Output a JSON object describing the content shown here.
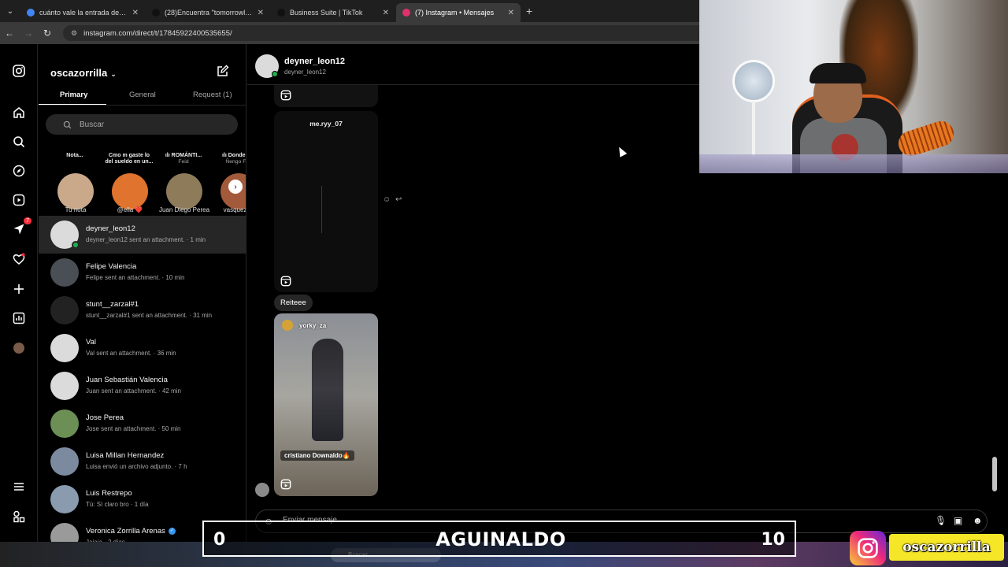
{
  "browser": {
    "tabs": [
      {
        "title": "cuánto vale la entrada de tomo",
        "active": false,
        "color": "#4285f4"
      },
      {
        "title": "(28)Encuentra \"tomorrowland b",
        "active": false,
        "color": "#111111"
      },
      {
        "title": "Business Suite | TikTok",
        "active": false,
        "color": "#111111"
      },
      {
        "title": "(7) Instagram • Mensajes",
        "active": true,
        "color": "#e1306c"
      }
    ],
    "new_tab": "+",
    "url": "instagram.com/direct/t/17845922400535655/"
  },
  "rail": {
    "messages_badge": "7"
  },
  "panel": {
    "account": "oscazorrilla",
    "tabs": [
      "Primary",
      "General",
      "Request (1)"
    ],
    "search_placeholder": "Buscar",
    "notes": [
      {
        "bubble": "Nota...",
        "bubble_sub": "",
        "name": "Tu nota",
        "bg": "#c9a98a"
      },
      {
        "bubble": "Cmo m gaste lo del sueldo en un...",
        "bubble_sub": "",
        "name": "@ella ❤️",
        "bg": "#e0732d"
      },
      {
        "bubble": "ılı ROMÁNTI...",
        "bubble_sub": "Feid",
        "name": "Juan Diego Perea",
        "bg": "#8d7b5a"
      },
      {
        "bubble": "ılı Donde (fe",
        "bubble_sub": "Ñengo Flo",
        "name": "vasquez_0",
        "bg": "#a35a3a"
      }
    ],
    "conversations": [
      {
        "name": "deyner_leon12",
        "preview": "deyner_leon12 sent an attachment. · 1 min",
        "selected": true,
        "online": true,
        "verified": false,
        "avatar": "#dbdbdb"
      },
      {
        "name": "Felipe Valencia",
        "preview": "Felipe sent an attachment. · 10 min",
        "selected": false,
        "online": false,
        "verified": false,
        "avatar": "#4a4e55"
      },
      {
        "name": "stunt__zarzal#1",
        "preview": "stunt__zarzal#1 sent an attachment. · 31 min",
        "selected": false,
        "online": false,
        "verified": false,
        "avatar": "#222222"
      },
      {
        "name": "Val",
        "preview": "Val sent an attachment. · 36 min",
        "selected": false,
        "online": false,
        "verified": false,
        "avatar": "#dbdbdb"
      },
      {
        "name": "Juan Sebastián Valencia",
        "preview": "Juan sent an attachment. · 42 min",
        "selected": false,
        "online": false,
        "verified": false,
        "avatar": "#dbdbdb"
      },
      {
        "name": "Jose Perea",
        "preview": "Jose sent an attachment. · 50 min",
        "selected": false,
        "online": false,
        "verified": false,
        "avatar": "#6b8f55"
      },
      {
        "name": "Luisa Millan Hernandez",
        "preview": "Luisa envió un archivo adjunto. · 7 h",
        "selected": false,
        "online": false,
        "verified": false,
        "avatar": "#7c8aa0"
      },
      {
        "name": "Luis Restrepo",
        "preview": "Tú: Sí claro bro · 1 día",
        "selected": false,
        "online": false,
        "verified": false,
        "avatar": "#8a9bb0"
      },
      {
        "name": "Veronica Zorrilla Arenas",
        "preview": "Jajaja · 2 días",
        "selected": false,
        "online": false,
        "verified": true,
        "avatar": "#9a9a9a"
      }
    ]
  },
  "chat": {
    "name": "deyner_leon12",
    "username": "deyner_leon12",
    "reel1_author": "me.ryy_07",
    "reel2_author": "yorky_za",
    "reel2_caption": "cristiano Downaldo🔥",
    "text_message": "Reiteee",
    "composer_placeholder": "Enviar mensaje..."
  },
  "overlay": {
    "left_score": "0",
    "title": "AGUINALDO",
    "right_score": "10",
    "handle": "oscazorrilla"
  },
  "taskbar": {
    "search": "Buscar"
  }
}
